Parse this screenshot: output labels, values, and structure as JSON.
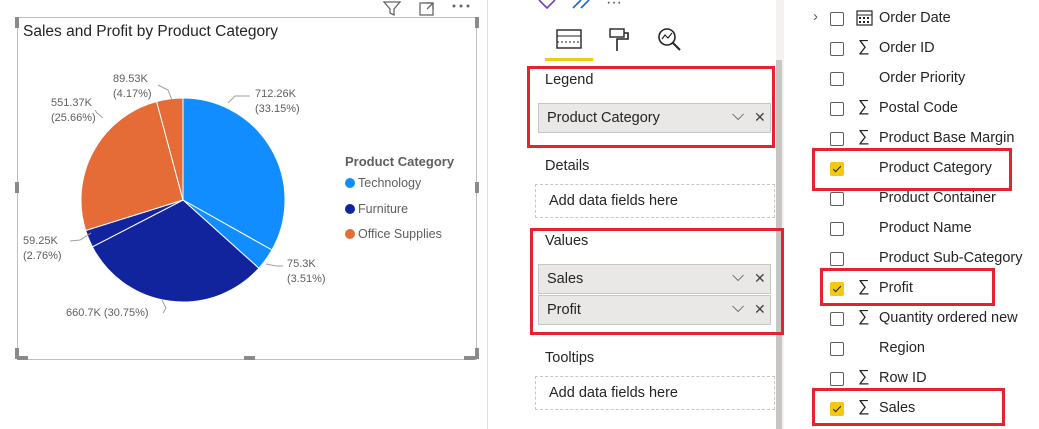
{
  "visual": {
    "title": "Sales and Profit by Product Category",
    "toolbar_icons": [
      "filter-icon",
      "focus-mode-icon",
      "more-options-icon"
    ]
  },
  "chart_data": {
    "type": "pie",
    "legend_title": "Product Category",
    "legend_position": "right",
    "slices": [
      {
        "category": "Technology",
        "measure": "Sales",
        "value": 712.26,
        "label": "712.26K",
        "percent": "(33.15%)",
        "color": "#118dff"
      },
      {
        "category": "Furniture",
        "measure": "Profit",
        "value": 75.3,
        "label": "75.3K",
        "percent": "(3.51%)",
        "color": "#118dff"
      },
      {
        "category": "Furniture",
        "measure": "Sales",
        "value": 660.7,
        "label": "660.7K (30.75%)",
        "percent": "",
        "color": "#12239e"
      },
      {
        "category": "Office Supplies",
        "measure": "Profit",
        "value": 59.25,
        "label": "59.25K",
        "percent": "(2.76%)",
        "color": "#12239e"
      },
      {
        "category": "Office Supplies",
        "measure": "Sales",
        "value": 551.37,
        "label": "551.37K",
        "percent": "(25.66%)",
        "color": "#e66c37"
      },
      {
        "category": "Technology",
        "measure": "Profit",
        "value": 89.53,
        "label": "89.53K",
        "percent": "(4.17%)",
        "color": "#e66c37"
      }
    ],
    "legend": [
      {
        "name": "Technology",
        "color": "#118dff"
      },
      {
        "name": "Furniture",
        "color": "#12239e"
      },
      {
        "name": "Office Supplies",
        "color": "#e66c37"
      }
    ]
  },
  "fields_pane": {
    "tabs": [
      "fields-tab-icon",
      "format-tab-icon",
      "analytics-tab-icon"
    ],
    "legend": {
      "label": "Legend",
      "field": "Product Category"
    },
    "details": {
      "label": "Details",
      "placeholder": "Add data fields here"
    },
    "values": {
      "label": "Values",
      "fields": [
        "Sales",
        "Profit"
      ]
    },
    "tooltips": {
      "label": "Tooltips",
      "placeholder": "Add data fields here"
    },
    "remove_glyph": "✕",
    "expand_glyph": "⌵"
  },
  "data_list": {
    "items": [
      {
        "label": "Order Date",
        "checked": false,
        "sigma": false,
        "calendar": true,
        "expander": true
      },
      {
        "label": "Order ID",
        "checked": false,
        "sigma": true
      },
      {
        "label": "Order Priority",
        "checked": false,
        "sigma": false
      },
      {
        "label": "Postal Code",
        "checked": false,
        "sigma": true
      },
      {
        "label": "Product Base Margin",
        "checked": false,
        "sigma": true
      },
      {
        "label": "Product Category",
        "checked": true,
        "sigma": false
      },
      {
        "label": "Product Container",
        "checked": false,
        "sigma": false
      },
      {
        "label": "Product Name",
        "checked": false,
        "sigma": false
      },
      {
        "label": "Product Sub-Category",
        "checked": false,
        "sigma": false
      },
      {
        "label": "Profit",
        "checked": true,
        "sigma": true
      },
      {
        "label": "Quantity ordered new",
        "checked": false,
        "sigma": true
      },
      {
        "label": "Region",
        "checked": false,
        "sigma": false
      },
      {
        "label": "Row ID",
        "checked": false,
        "sigma": true
      },
      {
        "label": "Sales",
        "checked": true,
        "sigma": true
      }
    ],
    "sigma_glyph": "∑"
  }
}
